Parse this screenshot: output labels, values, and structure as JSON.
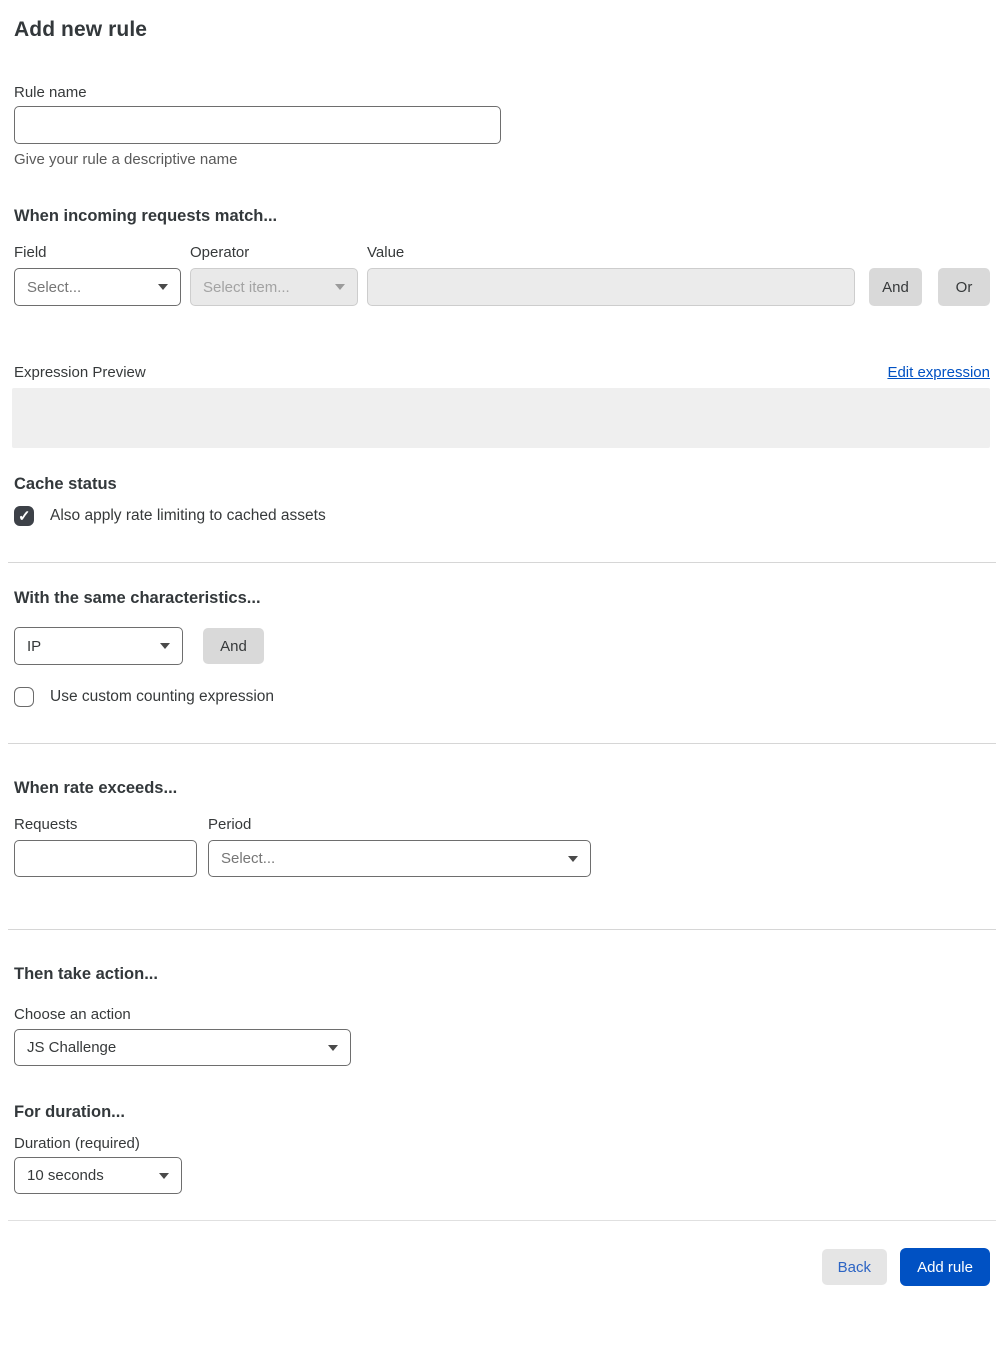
{
  "page": {
    "title": "Add new rule"
  },
  "rule_name": {
    "label": "Rule name",
    "value": "",
    "helper": "Give your rule a descriptive name"
  },
  "match_section": {
    "heading": "When incoming requests match...",
    "field": {
      "label": "Field",
      "value": "Select..."
    },
    "operator": {
      "label": "Operator",
      "value": "Select item..."
    },
    "value": {
      "label": "Value",
      "value": ""
    },
    "and_label": "And",
    "or_label": "Or",
    "expression_preview_label": "Expression Preview",
    "edit_expression_label": "Edit expression",
    "expression_value": ""
  },
  "cache_section": {
    "heading": "Cache status",
    "checkbox_label": "Also apply rate limiting to cached assets",
    "checked": true
  },
  "characteristics_section": {
    "heading": "With the same characteristics...",
    "select_value": "IP",
    "and_label": "And",
    "checkbox_label": "Use custom counting expression",
    "checked": false
  },
  "rate_section": {
    "heading": "When rate exceeds...",
    "requests": {
      "label": "Requests",
      "value": ""
    },
    "period": {
      "label": "Period",
      "value": "Select..."
    }
  },
  "action_section": {
    "heading": "Then take action...",
    "choose_label": "Choose an action",
    "action_value": "JS Challenge"
  },
  "duration_section": {
    "heading": "For duration...",
    "label": "Duration (required)",
    "value": "10 seconds"
  },
  "footer": {
    "back_label": "Back",
    "add_label": "Add rule"
  },
  "colors": {
    "accent_blue": "#0051c3",
    "disabled_gray": "#e9e9e9",
    "button_gray": "#d9d9d9",
    "checkbox_dark": "#3d4148"
  }
}
